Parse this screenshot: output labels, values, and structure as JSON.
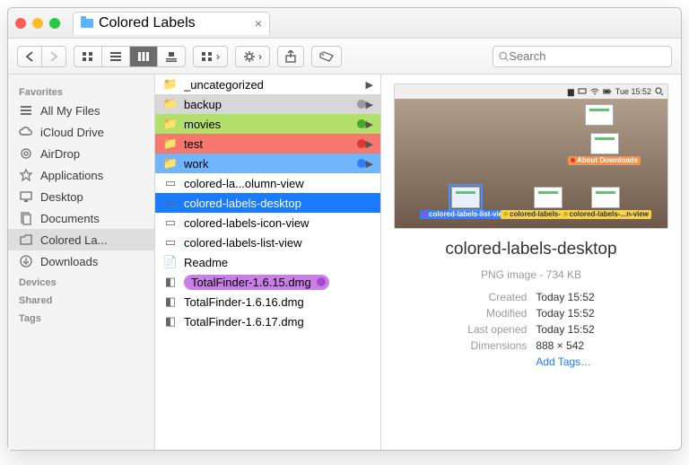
{
  "tab": {
    "title": "Colored Labels"
  },
  "search": {
    "placeholder": "Search"
  },
  "sidebar": {
    "sections": {
      "favorites": "Favorites",
      "devices": "Devices",
      "shared": "Shared",
      "tags": "Tags"
    },
    "items": [
      {
        "label": "All My Files",
        "icon": "all-my-files"
      },
      {
        "label": "iCloud Drive",
        "icon": "icloud"
      },
      {
        "label": "AirDrop",
        "icon": "airdrop"
      },
      {
        "label": "Applications",
        "icon": "applications"
      },
      {
        "label": "Desktop",
        "icon": "desktop"
      },
      {
        "label": "Documents",
        "icon": "documents"
      },
      {
        "label": "Colored La...",
        "icon": "folder",
        "selected": true
      },
      {
        "label": "Downloads",
        "icon": "downloads"
      }
    ]
  },
  "column": [
    {
      "label": "_uncategorized",
      "type": "folder",
      "arrow": true
    },
    {
      "label": "backup",
      "type": "folder",
      "bg": "gray",
      "arrow": true
    },
    {
      "label": "movies",
      "type": "folder",
      "bg": "green",
      "arrow": true
    },
    {
      "label": "test",
      "type": "folder",
      "bg": "red",
      "arrow": true
    },
    {
      "label": "work",
      "type": "folder",
      "bg": "blue",
      "arrow": true
    },
    {
      "label": "colored-la...olumn-view",
      "type": "image"
    },
    {
      "label": "colored-labels-desktop",
      "type": "image",
      "selected": true
    },
    {
      "label": "colored-labels-icon-view",
      "type": "image"
    },
    {
      "label": "colored-labels-list-view",
      "type": "image"
    },
    {
      "label": "Readme",
      "type": "file"
    },
    {
      "label": "TotalFinder-1.6.15.dmg",
      "type": "dmg",
      "pill": "purple"
    },
    {
      "label": "TotalFinder-1.6.16.dmg",
      "type": "dmg"
    },
    {
      "label": "TotalFinder-1.6.17.dmg",
      "type": "dmg"
    }
  ],
  "preview": {
    "menubar": {
      "time": "Tue 15:52"
    },
    "icons": {
      "about": "About Downloads",
      "list": "colored-labels-list-view",
      "iconv": "colored-labels-icon-view",
      "colv": "colored-labels-...n-view"
    },
    "filename": "colored-labels-desktop",
    "kind": "PNG image - 734 KB",
    "rows": {
      "created_k": "Created",
      "created_v": "Today 15:52",
      "modified_k": "Modified",
      "modified_v": "Today 15:52",
      "opened_k": "Last opened",
      "opened_v": "Today 15:52",
      "dim_k": "Dimensions",
      "dim_v": "888 × 542"
    },
    "add_tags": "Add Tags…"
  }
}
